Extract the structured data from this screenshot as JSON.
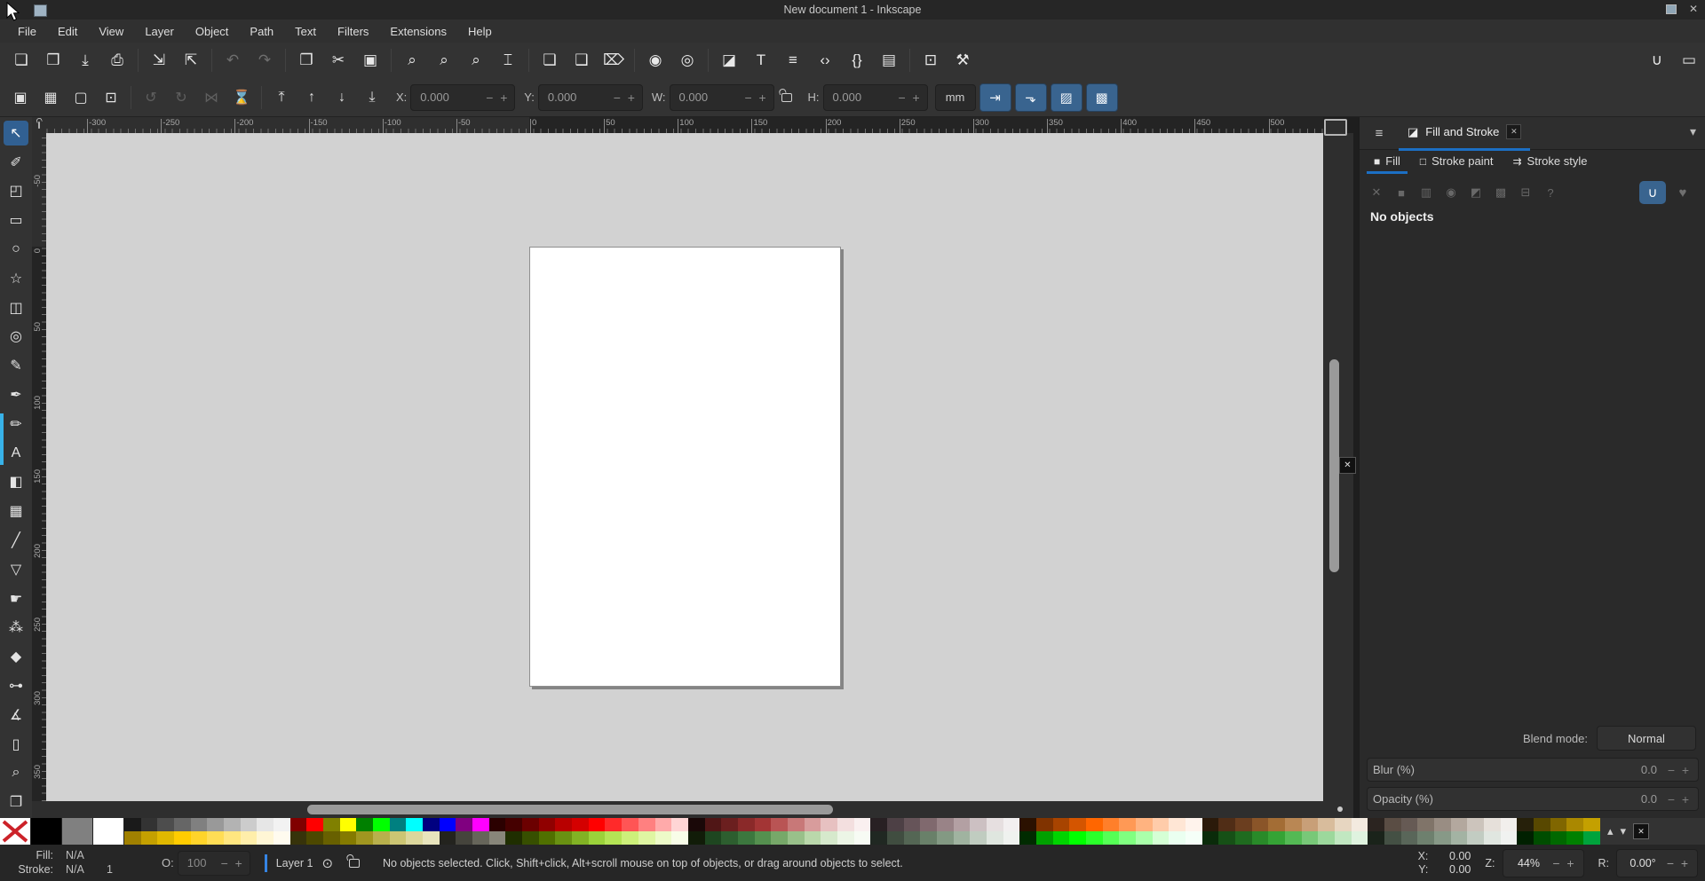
{
  "window": {
    "title": "New document 1 - Inkscape",
    "close_glyph": "✕"
  },
  "menu": {
    "items": [
      "File",
      "Edit",
      "View",
      "Layer",
      "Object",
      "Path",
      "Text",
      "Filters",
      "Extensions",
      "Help"
    ]
  },
  "command_bar": {
    "items": [
      {
        "name": "document-new-icon",
        "glyph": "❏"
      },
      {
        "name": "document-open-icon",
        "glyph": "❒"
      },
      {
        "name": "document-save-icon",
        "glyph": "⤓"
      },
      {
        "name": "print-icon",
        "glyph": "⎙"
      },
      {
        "sep": true
      },
      {
        "name": "import-icon",
        "glyph": "⇲"
      },
      {
        "name": "export-icon",
        "glyph": "⇱"
      },
      {
        "sep": true
      },
      {
        "name": "undo-icon",
        "glyph": "↶",
        "dim": true
      },
      {
        "name": "redo-icon",
        "glyph": "↷",
        "dim": true
      },
      {
        "sep": true
      },
      {
        "name": "copy-icon",
        "glyph": "❐"
      },
      {
        "name": "cut-icon",
        "glyph": "✂"
      },
      {
        "name": "paste-icon",
        "glyph": "▣"
      },
      {
        "sep": true
      },
      {
        "name": "zoom-selection-icon",
        "glyph": "⌕"
      },
      {
        "name": "zoom-drawing-icon",
        "glyph": "⌕"
      },
      {
        "name": "zoom-page-icon",
        "glyph": "⌕"
      },
      {
        "name": "zoom-page-width-icon",
        "glyph": "⌶"
      },
      {
        "sep": true
      },
      {
        "name": "duplicate-icon",
        "glyph": "❏"
      },
      {
        "name": "create-clone-icon",
        "glyph": "❑"
      },
      {
        "name": "unlink-clone-icon",
        "glyph": "⌦"
      },
      {
        "sep": true
      },
      {
        "name": "group-icon",
        "glyph": "◉"
      },
      {
        "name": "ungroup-icon",
        "glyph": "◎"
      },
      {
        "sep": true
      },
      {
        "name": "fill-stroke-dialog-icon",
        "glyph": "◪"
      },
      {
        "name": "text-dialog-icon",
        "glyph": "T"
      },
      {
        "name": "layers-dialog-icon",
        "glyph": "≡"
      },
      {
        "name": "xml-editor-icon",
        "glyph": "‹›"
      },
      {
        "name": "object-properties-icon",
        "glyph": "{}"
      },
      {
        "name": "align-distribute-icon",
        "glyph": "▤"
      },
      {
        "sep": true
      },
      {
        "name": "document-properties-icon",
        "glyph": "⊡"
      },
      {
        "name": "preferences-icon",
        "glyph": "⚒"
      },
      {
        "spacer": true
      },
      {
        "name": "snap-toggle-icon",
        "glyph": "∪"
      },
      {
        "name": "display-mode-icon",
        "glyph": "▭"
      }
    ]
  },
  "tool_options": {
    "select_buttons": [
      {
        "name": "select-all-button",
        "glyph": "▣"
      },
      {
        "name": "select-all-layers-button",
        "glyph": "▦"
      },
      {
        "name": "deselect-button",
        "glyph": "▢"
      },
      {
        "name": "selection-box-button",
        "glyph": "⊡"
      }
    ],
    "transform_buttons": [
      {
        "name": "rotate-ccw-button",
        "glyph": "↺",
        "dim": true
      },
      {
        "name": "rotate-cw-button",
        "glyph": "↻",
        "dim": true
      },
      {
        "name": "flip-horizontal-button",
        "glyph": "⋈",
        "dim": true
      },
      {
        "name": "flip-vertical-button",
        "glyph": "⌛",
        "dim": true
      }
    ],
    "zorder_buttons": [
      {
        "name": "raise-to-top-button",
        "glyph": "⤒"
      },
      {
        "name": "raise-button",
        "glyph": "↑"
      },
      {
        "name": "lower-button",
        "glyph": "↓"
      },
      {
        "name": "lower-to-bottom-button",
        "glyph": "⤓"
      }
    ],
    "fields": [
      {
        "id": "x",
        "label": "X:",
        "value": "0.000"
      },
      {
        "id": "y",
        "label": "Y:",
        "value": "0.000"
      },
      {
        "id": "w",
        "label": "W:",
        "value": "0.000"
      },
      {
        "id": "h",
        "label": "H:",
        "value": "0.000"
      }
    ],
    "unit": "mm",
    "affect_toggles": [
      {
        "name": "affect-move-button",
        "glyph": "⇥"
      },
      {
        "name": "affect-corners-button",
        "glyph": "⬎"
      },
      {
        "name": "affect-gradients-button",
        "glyph": "▨"
      },
      {
        "name": "affect-patterns-button",
        "glyph": "▩"
      }
    ]
  },
  "toolbox": {
    "tools": [
      {
        "id": "selector",
        "glyph": "↖",
        "active": true
      },
      {
        "id": "node-editor",
        "glyph": "✐"
      },
      {
        "id": "shape-builder",
        "glyph": "◰"
      },
      {
        "id": "rectangle",
        "glyph": "▭"
      },
      {
        "id": "ellipse",
        "glyph": "○"
      },
      {
        "id": "star",
        "glyph": "☆"
      },
      {
        "id": "box-3d",
        "glyph": "◫"
      },
      {
        "id": "spiral",
        "glyph": "◎"
      },
      {
        "id": "pencil",
        "glyph": "✎"
      },
      {
        "id": "bezier-pen",
        "glyph": "✒"
      },
      {
        "id": "calligraphy",
        "glyph": "✏"
      },
      {
        "id": "text",
        "glyph": "A"
      },
      {
        "id": "gradient",
        "glyph": "◧"
      },
      {
        "id": "mesh-gradient",
        "glyph": "▦"
      },
      {
        "id": "dropper",
        "glyph": "╱"
      },
      {
        "id": "paint-bucket",
        "glyph": "▽"
      },
      {
        "id": "tweak",
        "glyph": "☛"
      },
      {
        "id": "spray",
        "glyph": "⁂"
      },
      {
        "id": "eraser",
        "glyph": "◆"
      },
      {
        "id": "connector",
        "glyph": "⊶"
      },
      {
        "id": "measure",
        "glyph": "∡"
      },
      {
        "id": "page-tool",
        "glyph": "▯"
      },
      {
        "id": "zoom-tool",
        "glyph": "⌕"
      },
      {
        "id": "pages",
        "glyph": "❐"
      }
    ]
  },
  "rulers": {
    "top_labels": [
      -300,
      -250,
      -200,
      -150,
      -100,
      -50,
      0,
      50,
      100,
      150,
      200,
      250,
      300,
      350,
      400,
      450,
      500
    ],
    "left_labels": [
      -50,
      0,
      50,
      100,
      150,
      200,
      250,
      300,
      350
    ]
  },
  "panel": {
    "dock_tab_label": "Fill and Stroke",
    "tabs": [
      {
        "label": "Fill",
        "glyph": "■",
        "active": true
      },
      {
        "label": "Stroke paint",
        "glyph": "□",
        "active": false
      },
      {
        "label": "Stroke style",
        "glyph": "⇉",
        "active": false
      }
    ],
    "paint_types": [
      {
        "name": "paint-none-icon",
        "glyph": "✕"
      },
      {
        "name": "paint-flat-icon",
        "glyph": "■"
      },
      {
        "name": "paint-linear-gradient-icon",
        "glyph": "▥"
      },
      {
        "name": "paint-radial-gradient-icon",
        "glyph": "◉"
      },
      {
        "name": "paint-pattern-icon",
        "glyph": "◩"
      },
      {
        "name": "paint-swatch-icon",
        "glyph": "▩"
      },
      {
        "name": "paint-mesh-icon",
        "glyph": "⊟"
      },
      {
        "name": "paint-unknown-icon",
        "glyph": "?"
      }
    ],
    "fill_rules": [
      {
        "name": "fill-rule-evenodd-button",
        "glyph": "∪",
        "active": true
      },
      {
        "name": "fill-rule-nonzero-button",
        "glyph": "♥",
        "active": false
      }
    ],
    "no_objects": "No objects",
    "blend_label": "Blend mode:",
    "blend_value": "Normal",
    "blur_label": "Blur (%)",
    "blur_value": "0.0",
    "opacity_label": "Opacity (%)",
    "opacity_value": "0.0"
  },
  "palette": {
    "pinned": [
      "#000000",
      "#808080",
      "#ffffff"
    ],
    "row1": [
      "#1a1a1a",
      "#333333",
      "#4d4d4d",
      "#666666",
      "#808080",
      "#999999",
      "#b3b3b3",
      "#cccccc",
      "#e6e6e6",
      "#f2f2f2",
      "#800000",
      "#ff0000",
      "#808000",
      "#ffff00",
      "#008000",
      "#00ff00",
      "#008080",
      "#00ffff",
      "#000080",
      "#0000ff",
      "#800080",
      "#ff00ff",
      "#2b0000",
      "#450000",
      "#6b0000",
      "#900000",
      "#b80000",
      "#d40000",
      "#ff0000",
      "#ff2a2a",
      "#ff5555",
      "#ff8080",
      "#ffaaaa",
      "#ffd5d5",
      "#1a0808",
      "#501616",
      "#6b1f1f",
      "#8a2929",
      "#a33535",
      "#b95454",
      "#c87878",
      "#d89c9c",
      "#e7c1c1",
      "#f3dfdf",
      "#faf0f0",
      "#282023",
      "#4d4045",
      "#665459",
      "#80696e",
      "#998387",
      "#b3a0a3",
      "#ccc0c2",
      "#e6dfe0",
      "#f2eff0",
      "#2b1100",
      "#803300",
      "#a84400",
      "#d45500",
      "#ff6600",
      "#ff7f2a",
      "#ff9955",
      "#ffb380",
      "#ffccaa",
      "#ffe6d5",
      "#fff3ec",
      "#2b1a0a",
      "#502d16",
      "#6b3e1f",
      "#8a5529",
      "#a36d35",
      "#b98754",
      "#c89f78",
      "#d8bc9c",
      "#e7d6c1",
      "#f3eadf",
      "#2b2420",
      "#5a4d44",
      "#665a54",
      "#807469",
      "#998d83",
      "#b3a89e",
      "#ccc4bc",
      "#e6e0da",
      "#f2efec",
      "#26200a",
      "#584800",
      "#806600",
      "#aa8800",
      "#c4a000"
    ],
    "row2": [
      "#a08000",
      "#c4a000",
      "#e0b800",
      "#ffcc00",
      "#ffd42a",
      "#ffdd55",
      "#ffe680",
      "#ffeeaa",
      "#fff6d5",
      "#fffbef",
      "#37330a",
      "#4d4800",
      "#686000",
      "#847a00",
      "#a09620",
      "#b8b04c",
      "#ccc573",
      "#dcd79c",
      "#e8e4bd",
      "#23231e",
      "#45443c",
      "#66655a",
      "#88867a",
      "#1f2e00",
      "#374f00",
      "#507000",
      "#699112",
      "#82b224",
      "#9bd23a",
      "#b4e455",
      "#cdf07a",
      "#dff5a2",
      "#edfac8",
      "#f8fde8",
      "#111c08",
      "#1e4620",
      "#2d5e2f",
      "#3c773e",
      "#55904f",
      "#77a869",
      "#99c08a",
      "#bad8ab",
      "#d6e9cc",
      "#ecf5e6",
      "#f7fbf4",
      "#202822",
      "#404d40",
      "#546654",
      "#698069",
      "#839983",
      "#a0b3a0",
      "#c0ccc0",
      "#dfe6df",
      "#eff2ef",
      "#002b00",
      "#00a000",
      "#00d400",
      "#00ff00",
      "#2aff2a",
      "#55ff55",
      "#80ff80",
      "#aaffaa",
      "#d5ffd5",
      "#eafff0",
      "#f5fff8",
      "#0a2b0a",
      "#165016",
      "#1f6b1f",
      "#298a29",
      "#35a335",
      "#54b954",
      "#78c878",
      "#9cd89c",
      "#c1e7c1",
      "#dff3df",
      "#1a231a",
      "#445044",
      "#596659",
      "#6e806e",
      "#879987",
      "#a3b3a3",
      "#c2ccc2",
      "#e0e6e0",
      "#f0f2f0",
      "#002000",
      "#004d00",
      "#006800",
      "#008000",
      "#00a33c"
    ]
  },
  "status": {
    "fill_label": "Fill:",
    "fill_value": "N/A",
    "stroke_label": "Stroke:",
    "stroke_value": "N/A",
    "stroke_width": "1",
    "opacity_label": "O:",
    "opacity_value": "100",
    "layer_name": "Layer 1",
    "message": "No objects selected. Click, Shift+click, Alt+scroll mouse on top of objects, or drag around objects to select.",
    "x_label": "X:",
    "x_value": "0.00",
    "y_label": "Y:",
    "y_value": "0.00",
    "zoom_label": "Z:",
    "zoom_value": "44%",
    "rotation_label": "R:",
    "rotation_value": "0.00°"
  },
  "colors": {
    "accent_blue": "#1c6fc4",
    "button_blue": "#39648f",
    "canvas_gray": "#d2d2d2",
    "layer_indicator": "#3584e4",
    "none_x_red": "#cc2229"
  }
}
